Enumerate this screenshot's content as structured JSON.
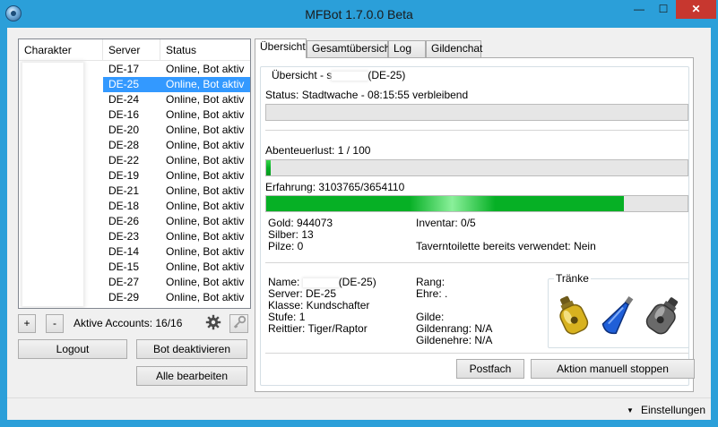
{
  "window": {
    "title": "MFBot 1.7.0.0 Beta",
    "min_glyph": "—",
    "max_glyph": "☐",
    "close_glyph": "✕",
    "accent": "#2b9fd9",
    "close_color": "#c7372f"
  },
  "charlist": {
    "headers": {
      "character": "Charakter",
      "server": "Server",
      "status": "Status"
    },
    "rows": [
      {
        "server": "DE-17",
        "status": "Online, Bot aktiv"
      },
      {
        "server": "DE-25",
        "status": "Online, Bot aktiv",
        "selected": true
      },
      {
        "server": "DE-24",
        "status": "Online, Bot aktiv"
      },
      {
        "server": "DE-16",
        "status": "Online, Bot aktiv"
      },
      {
        "server": "DE-20",
        "status": "Online, Bot aktiv"
      },
      {
        "server": "DE-28",
        "status": "Online, Bot aktiv"
      },
      {
        "server": "DE-22",
        "status": "Online, Bot aktiv"
      },
      {
        "server": "DE-19",
        "status": "Online, Bot aktiv"
      },
      {
        "server": "DE-21",
        "status": "Online, Bot aktiv"
      },
      {
        "server": "DE-18",
        "status": "Online, Bot aktiv"
      },
      {
        "server": "DE-26",
        "status": "Online, Bot aktiv"
      },
      {
        "server": "DE-23",
        "status": "Online, Bot aktiv"
      },
      {
        "server": "DE-14",
        "status": "Online, Bot aktiv"
      },
      {
        "server": "DE-15",
        "status": "Online, Bot aktiv"
      },
      {
        "server": "DE-27",
        "status": "Online, Bot aktiv"
      },
      {
        "server": "DE-29",
        "status": "Online, Bot aktiv"
      }
    ],
    "selection_color": "#3399ff"
  },
  "controls": {
    "plus": "+",
    "minus": "-",
    "accounts": "Aktive Accounts: 16/16",
    "gear_icon": "gear-icon",
    "key_icon": "key-icon",
    "logout": "Logout",
    "deactivate": "Bot deaktivieren",
    "edit_all": "Alle bearbeiten"
  },
  "tabs": [
    "Übersicht",
    "Gesamtübersicht",
    "Log",
    "Gildenchat"
  ],
  "overview": {
    "legend_prefix": "Übersicht - s",
    "legend_suffix": "(DE-25)",
    "status": "Status: Stadtwache - 08:15:55 verbleibend",
    "status_progress": 0,
    "adventure": "Abenteuerlust: 1 / 100",
    "adventure_progress": 0.01,
    "experience": "Erfahrung: 3103765/3654110",
    "experience_progress": 0.849,
    "gold": "Gold: 944073",
    "silver": "Silber: 13",
    "mushrooms": "Pilze: 0",
    "inventory": "Inventar: 0/5",
    "tavern": "Taverntoilette bereits verwendet: Nein",
    "name_label": "Name:",
    "name_suffix": "(DE-25)",
    "server": "Server: DE-25",
    "class": "Klasse: Kundschafter",
    "level_label": "Stufe: 1",
    "mount": "Reittier: Tiger/Raptor",
    "rank_label": "Rang:",
    "honor_label": "Ehre: .",
    "guild_label": "Gilde:",
    "guild_rank": "Gildenrang: N/A",
    "guild_honor": "Gildenehre: N/A",
    "potions_legend": "Tränke",
    "potion_colors": [
      "#d8b21f",
      "#1f5fd8",
      "#6a6a6a"
    ],
    "mailbox": "Postfach",
    "stop_action": "Aktion manuell stoppen",
    "progress_color": "#06b025"
  },
  "statusbar": {
    "settings": "Einstellungen",
    "arrow_glyph": "▼"
  }
}
